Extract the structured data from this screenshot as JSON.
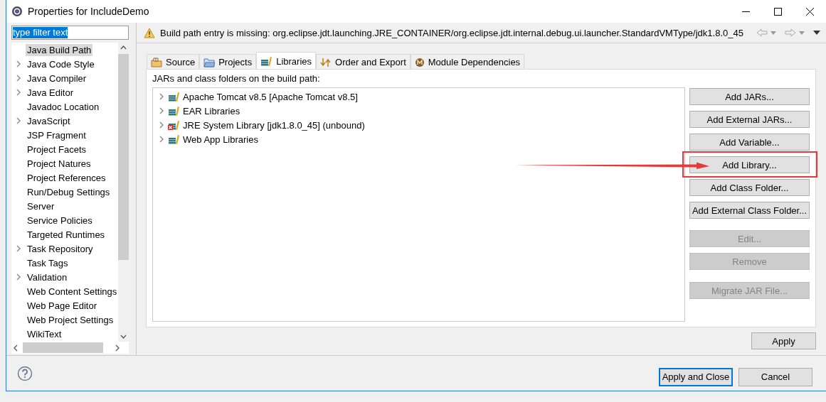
{
  "window": {
    "title": "Properties for IncludeDemo"
  },
  "filter": {
    "value": "type filter text",
    "text_selected": true
  },
  "nav_tree": {
    "items": [
      {
        "label": "Java Build Path",
        "expandable": false,
        "selected": true
      },
      {
        "label": "Java Code Style",
        "expandable": true,
        "selected": false
      },
      {
        "label": "Java Compiler",
        "expandable": true,
        "selected": false
      },
      {
        "label": "Java Editor",
        "expandable": true,
        "selected": false
      },
      {
        "label": "Javadoc Location",
        "expandable": false,
        "selected": false
      },
      {
        "label": "JavaScript",
        "expandable": true,
        "selected": false
      },
      {
        "label": "JSP Fragment",
        "expandable": false,
        "selected": false
      },
      {
        "label": "Project Facets",
        "expandable": false,
        "selected": false
      },
      {
        "label": "Project Natures",
        "expandable": false,
        "selected": false
      },
      {
        "label": "Project References",
        "expandable": false,
        "selected": false
      },
      {
        "label": "Run/Debug Settings",
        "expandable": false,
        "selected": false
      },
      {
        "label": "Server",
        "expandable": false,
        "selected": false
      },
      {
        "label": "Service Policies",
        "expandable": false,
        "selected": false
      },
      {
        "label": "Targeted Runtimes",
        "expandable": false,
        "selected": false
      },
      {
        "label": "Task Repository",
        "expandable": true,
        "selected": false
      },
      {
        "label": "Task Tags",
        "expandable": false,
        "selected": false
      },
      {
        "label": "Validation",
        "expandable": true,
        "selected": false
      },
      {
        "label": "Web Content Settings",
        "expandable": false,
        "selected": false
      },
      {
        "label": "Web Page Editor",
        "expandable": false,
        "selected": false
      },
      {
        "label": "Web Project Settings",
        "expandable": false,
        "selected": false
      },
      {
        "label": "WikiText",
        "expandable": false,
        "selected": false
      }
    ]
  },
  "message": {
    "kind": "warning",
    "text": "Build path entry is missing: org.eclipse.jdt.launching.JRE_CONTAINER/org.eclipse.jdt.internal.debug.ui.launcher.StandardVMType/jdk1.8.0_45"
  },
  "tabs": [
    {
      "label": "Source",
      "kind": "source",
      "selected": false
    },
    {
      "label": "Projects",
      "kind": "projects",
      "selected": false
    },
    {
      "label": "Libraries",
      "kind": "libraries",
      "selected": true
    },
    {
      "label": "Order and Export",
      "kind": "order",
      "selected": false
    },
    {
      "label": "Module Dependencies",
      "kind": "module",
      "selected": false
    }
  ],
  "libraries": {
    "caption": "JARs and class folders on the build path:",
    "entries": [
      {
        "label": "Apache Tomcat v8.5 [Apache Tomcat v8.5]",
        "error": false
      },
      {
        "label": "EAR Libraries",
        "error": false
      },
      {
        "label": "JRE System Library [jdk1.8.0_45] (unbound)",
        "error": true
      },
      {
        "label": "Web App Libraries",
        "error": false
      }
    ]
  },
  "button_groups": [
    [
      {
        "label": "Add JARs...",
        "disabled": false,
        "highlighted": false
      },
      {
        "label": "Add External JARs...",
        "disabled": false,
        "highlighted": false
      },
      {
        "label": "Add Variable...",
        "disabled": false,
        "highlighted": false
      },
      {
        "label": "Add Library...",
        "disabled": false,
        "highlighted": true
      },
      {
        "label": "Add Class Folder...",
        "disabled": false,
        "highlighted": false
      },
      {
        "label": "Add External Class Folder...",
        "disabled": false,
        "highlighted": false
      }
    ],
    [
      {
        "label": "Edit...",
        "disabled": true,
        "highlighted": false
      },
      {
        "label": "Remove",
        "disabled": true,
        "highlighted": false
      }
    ],
    [
      {
        "label": "Migrate JAR File...",
        "disabled": true,
        "highlighted": false
      }
    ]
  ],
  "apply_button": {
    "label": "Apply"
  },
  "dialog_buttons": [
    {
      "label": "Apply and Close",
      "default": true
    },
    {
      "label": "Cancel",
      "default": false
    }
  ]
}
